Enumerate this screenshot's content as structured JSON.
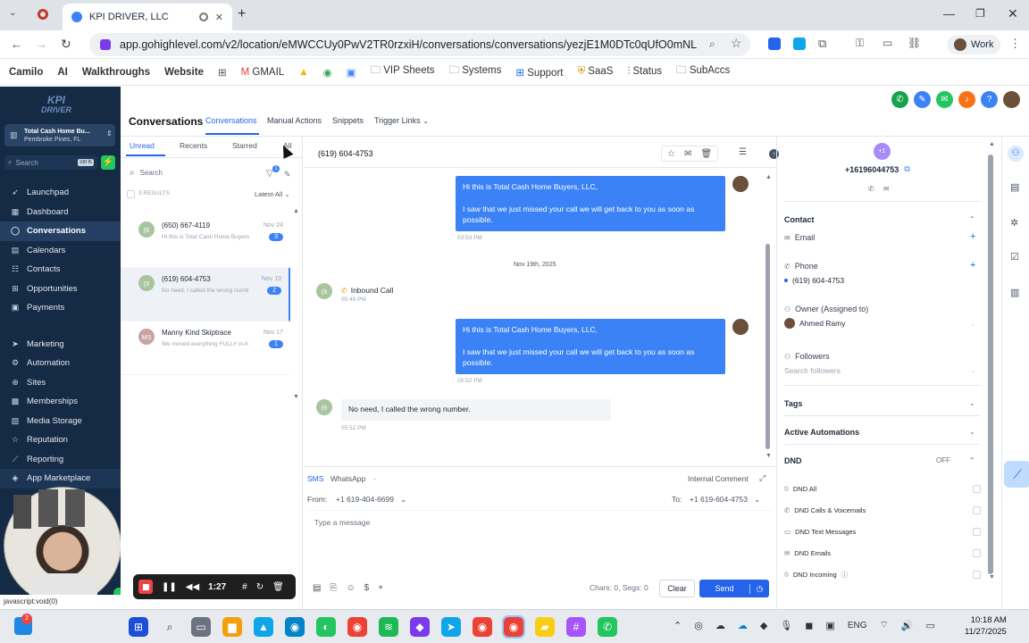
{
  "browser": {
    "tab_title": "KPI DRIVER, LLC",
    "url": "app.gohighlevel.com/v2/location/eMWCCUy0PwV2TR0rzxiH/conversations/conversations/yezjE1M0DTc0qUfO0mNL",
    "profile": "Work",
    "bookmarks": [
      "Camilo",
      "AI",
      "Walkthroughs",
      "Website",
      "GMAIL",
      "VIP Sheets",
      "Systems",
      "Support",
      "SaaS",
      "Status",
      "SubAccs"
    ]
  },
  "sidebar": {
    "logo_top": "KPI",
    "logo_bottom": "DRIVER",
    "account_name": "Total Cash Home Bu...",
    "account_location": "Pembroke Pines, FL",
    "search_placeholder": "Search",
    "search_shortcut": "ctrl K",
    "items": [
      "Launchpad",
      "Dashboard",
      "Conversations",
      "Calendars",
      "Contacts",
      "Opportunities",
      "Payments",
      "Marketing",
      "Automation",
      "Sites",
      "Memberships",
      "Media Storage",
      "Reputation",
      "Reporting",
      "App Marketplace"
    ],
    "status_text": "javascript:void(0)"
  },
  "header": {
    "title": "Conversations",
    "tabs": [
      "Conversations",
      "Manual Actions",
      "Snippets",
      "Trigger Links"
    ]
  },
  "list": {
    "filters": [
      "Unread",
      "Recents",
      "Starred",
      "All"
    ],
    "search_placeholder": "Search",
    "results": "3 RESULTS",
    "sort": "Latest-All",
    "filter_count": "1",
    "items": [
      {
        "initials": "(6",
        "name": "(650) 667-4119",
        "date": "Nov 24",
        "preview": "Hi this is Total Cash Home Buyers",
        "count": "3"
      },
      {
        "initials": "(6",
        "name": "(619) 604-4753",
        "date": "Nov 19",
        "preview": "No need, I called the wrong numb",
        "count": "2"
      },
      {
        "initials": "MS",
        "name": "Manny Kind Skiptrace",
        "date": "Nov 17",
        "preview": "We moved everything FULLY in-h",
        "count": "1"
      }
    ]
  },
  "chat": {
    "contact": "(619) 604-4753",
    "messages": [
      {
        "line1": "Hi this is Total Cash Home Buyers, LLC,",
        "line2": "I saw that we just missed your call we will get back to you as soon as possible.",
        "time": "03:53 PM"
      },
      {
        "date_divider": "Nov 19th, 2025"
      },
      {
        "label": "Inbound Call",
        "time": "05:49 PM"
      },
      {
        "line1": "Hi this is Total Cash Home Buyers, LLC,",
        "line2": "I saw that we just missed your call we will get back to you as soon as possible.",
        "time": "05:52 PM"
      },
      {
        "text": "No need, I called the wrong number.",
        "time": "05:52 PM"
      }
    ],
    "avatar_initials": "(6"
  },
  "composer": {
    "tabs": [
      "SMS",
      "WhatsApp",
      "-"
    ],
    "internal_comment": "Internal Comment",
    "from_label": "From:",
    "from_value": "+1 619-404-6699",
    "to_label": "To:",
    "to_value": "+1 619-604-4753",
    "placeholder": "Type a message",
    "counter": "Chars: 0, Segs: 0",
    "clear": "Clear",
    "send": "Send"
  },
  "details": {
    "avatar": "+1",
    "phone_title": "+16196044753",
    "contact_header": "Contact",
    "email_label": "Email",
    "phone_label": "Phone",
    "phone_value": "(619) 604-4753",
    "owner_label": "Owner (Assigned to)",
    "owner_value": "Ahmed Ramy",
    "followers_label": "Followers",
    "followers_placeholder": "Search followers",
    "tags": "Tags",
    "automations": "Active Automations",
    "dnd": "DND",
    "dnd_state": "OFF",
    "dnd_items": [
      "DND All",
      "DND Calls & Voicemails",
      "DND Text Messages",
      "DND Emails",
      "DND Incoming"
    ]
  },
  "recorder": {
    "time": "1:27"
  },
  "taskbar": {
    "language": "ENG",
    "time": "10:18 AM",
    "date": "11/27/2025",
    "notification_count": "2"
  },
  "colors": {
    "sidebar_bg": "#152a44",
    "accent_blue": "#3b82f6",
    "send_button": "#2563eb"
  }
}
